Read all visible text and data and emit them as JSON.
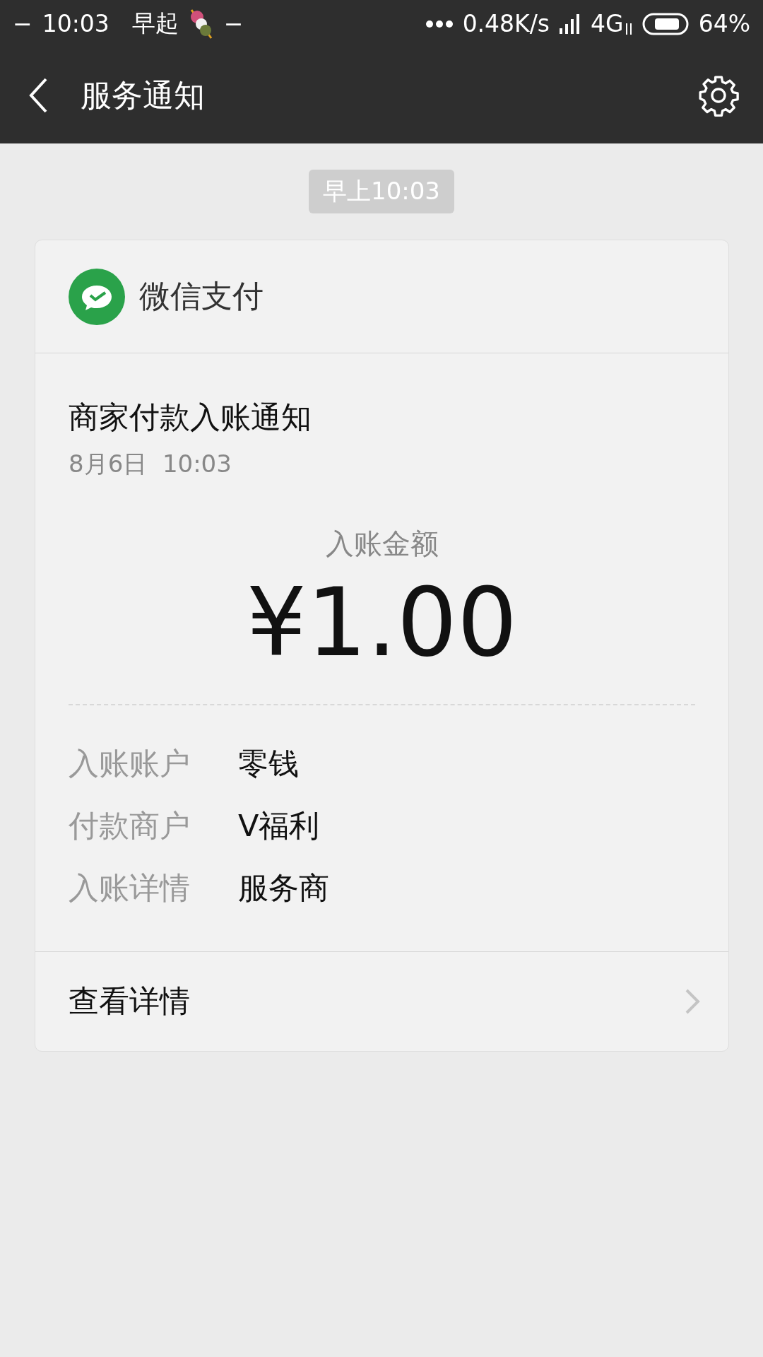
{
  "status_bar": {
    "left_dash": "−",
    "time": "10:03",
    "note": "早起",
    "right_dash": "−",
    "speed": "0.48K/s",
    "network": "4G",
    "battery": "64%"
  },
  "nav_bar": {
    "title": "服务通知"
  },
  "timestamp": "早上10:03",
  "card": {
    "source": "微信支付",
    "title": "商家付款入账通知",
    "date": "8月6日  10:03",
    "amount_label": "入账金额",
    "amount": "¥1.00",
    "details": [
      {
        "label": "入账账户",
        "value": "零钱"
      },
      {
        "label": "付款商户",
        "value": "V福利"
      },
      {
        "label": "入账详情",
        "value": "服务商"
      }
    ],
    "footer_link": "查看详情"
  }
}
